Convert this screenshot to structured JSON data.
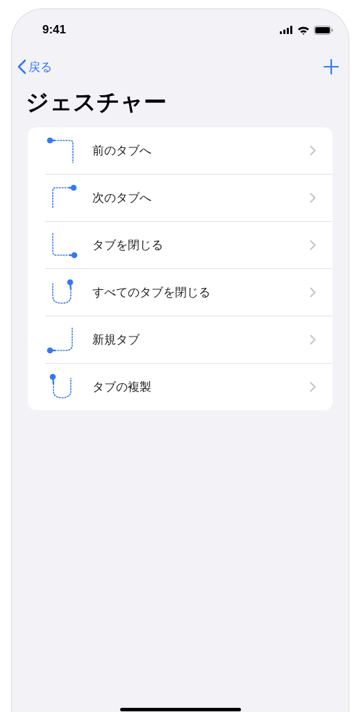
{
  "status_bar": {
    "time": "9:41"
  },
  "nav": {
    "back": "戻る"
  },
  "title": "ジェスチャー",
  "gestures": [
    {
      "label": "前のタブへ",
      "kind": "back"
    },
    {
      "label": "次のタブへ",
      "kind": "forward"
    },
    {
      "label": "タブを閉じる",
      "kind": "close"
    },
    {
      "label": "すべてのタブを閉じる",
      "kind": "close-all"
    },
    {
      "label": "新規タブ",
      "kind": "new"
    },
    {
      "label": "タブの複製",
      "kind": "duplicate"
    }
  ]
}
